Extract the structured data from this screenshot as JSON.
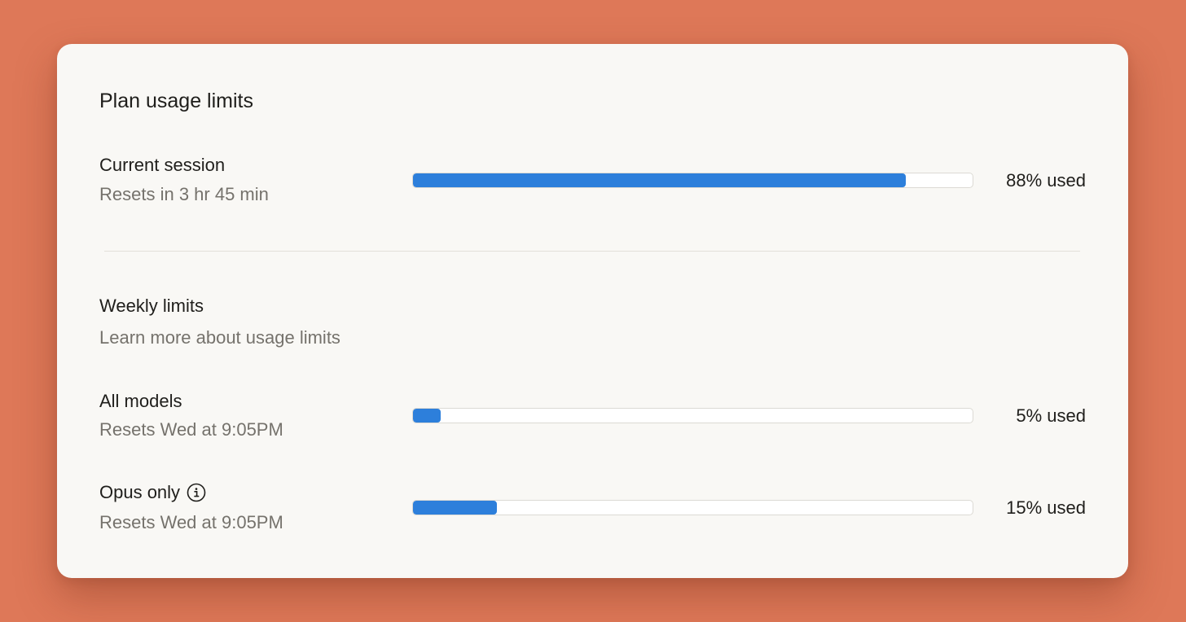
{
  "panel": {
    "title": "Plan usage limits"
  },
  "current_session": {
    "label": "Current session",
    "reset": "Resets in 3 hr 45 min",
    "used_fraction": 0.88,
    "used_label": "88% used"
  },
  "weekly": {
    "heading": "Weekly limits",
    "learn_more": "Learn more about usage limits"
  },
  "all_models": {
    "label": "All models",
    "reset": "Resets Wed at 9:05PM",
    "used_fraction": 0.05,
    "used_label": "5% used"
  },
  "opus_only": {
    "label": "Opus only",
    "info_icon": "info-icon",
    "reset": "Resets Wed at 9:05PM",
    "used_fraction": 0.15,
    "used_label": "15% used"
  },
  "colors": {
    "background": "#de7858",
    "card": "#f9f8f5",
    "bar_fill": "#2d7fdb"
  }
}
